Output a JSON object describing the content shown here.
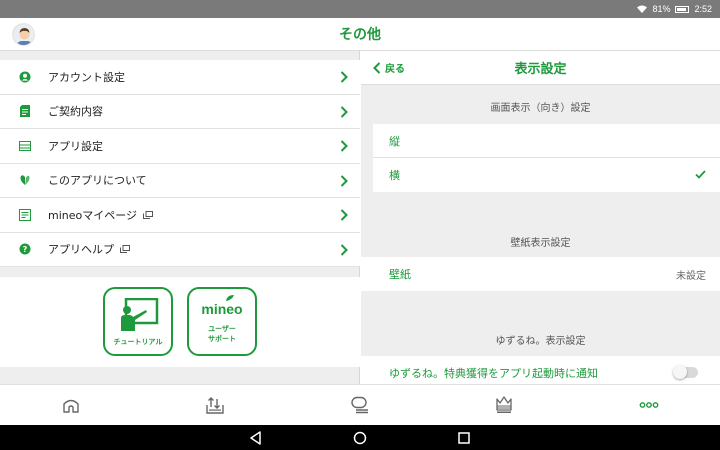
{
  "status_bar": {
    "battery": "81%",
    "time": "2:52"
  },
  "header": {
    "title": "その他"
  },
  "menu": {
    "items": [
      {
        "label": "アカウント設定",
        "icon": "account-icon"
      },
      {
        "label": "ご契約内容",
        "icon": "contract-icon"
      },
      {
        "label": "アプリ設定",
        "icon": "app-settings-icon"
      },
      {
        "label": "このアプリについて",
        "icon": "about-icon"
      },
      {
        "label": "mineoマイページ",
        "icon": "mypage-icon",
        "external": true
      },
      {
        "label": "アプリヘルプ",
        "icon": "help-icon",
        "external": true
      }
    ]
  },
  "tiles": {
    "tutorial": {
      "label": "チュートリアル"
    },
    "support": {
      "logo": "mineo",
      "line1": "ユーザー",
      "line2": "サポート"
    }
  },
  "display_settings": {
    "back_label": "戻る",
    "title": "表示設定",
    "orientation": {
      "section": "画面表示（向き）設定",
      "options": [
        {
          "label": "縦",
          "selected": false
        },
        {
          "label": "横",
          "selected": true
        }
      ]
    },
    "wallpaper": {
      "section": "壁紙表示設定",
      "label": "壁紙",
      "value": "未設定"
    },
    "yuzuru": {
      "section": "ゆずるね。表示設定",
      "label": "ゆずるね。特典獲得をアプリ起動時に通知",
      "enabled": false
    }
  },
  "tabbar": {
    "tabs": [
      "home-icon",
      "upload-icon",
      "chat-icon",
      "crown-icon",
      "more-icon"
    ],
    "active_index": 4
  },
  "colors": {
    "accent": "#1e9a3c",
    "background": "#eeeeee",
    "status_bar": "#7a7a7a"
  }
}
